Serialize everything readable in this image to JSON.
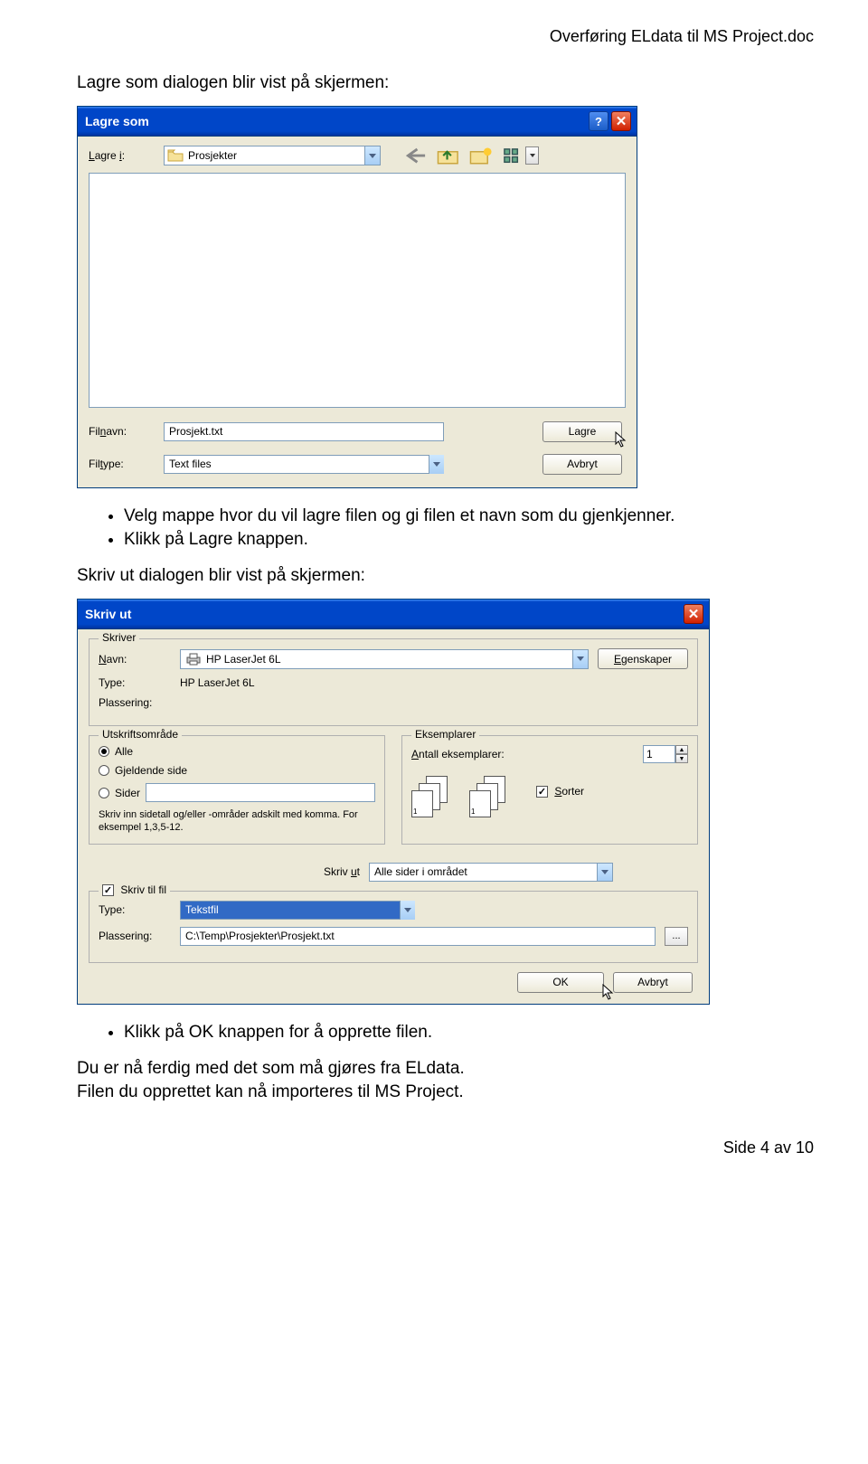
{
  "doc_header": "Overføring ELdata til MS Project.doc",
  "intro_text": "Lagre som dialogen blir vist på skjermen:",
  "saveas": {
    "title": "Lagre som",
    "savein_label": "Lagre i:",
    "folder": "Prosjekter",
    "filename_label": "Filnavn:",
    "filename_value": "Prosjekt.txt",
    "filetype_label": "Filtype:",
    "filetype_value": "Text files",
    "save_btn": "Lagre",
    "cancel_btn": "Avbryt"
  },
  "bullets_after_saveas": [
    "Velg mappe hvor du vil lagre filen og gi filen et navn som du gjenkjenner.",
    "Klikk på Lagre knappen."
  ],
  "print_intro": "Skriv ut dialogen blir vist på skjermen:",
  "print": {
    "title": "Skriv ut",
    "printer_legend": "Skriver",
    "name_label": "Navn:",
    "name_value": "HP LaserJet 6L",
    "type_label": "Type:",
    "type_value": "HP LaserJet 6L",
    "location_label": "Plassering:",
    "props_btn": "Egenskaper",
    "range_legend": "Utskriftsområde",
    "range_all": "Alle",
    "range_current": "Gjeldende side",
    "range_pages": "Sider",
    "range_note": "Skriv inn sidetall og/eller -områder adskilt med komma. For eksempel 1,3,5-12.",
    "copies_legend": "Eksemplarer",
    "copies_label": "Antall eksemplarer:",
    "copies_value": "1",
    "collate": "Sorter",
    "print_what_label": "Skriv ut",
    "print_what_value": "Alle sider i området",
    "to_file_legend": "Skriv til fil",
    "to_file_type_label": "Type:",
    "to_file_type_value": "Tekstfil",
    "to_file_loc_label": "Plassering:",
    "to_file_loc_value": "C:\\Temp\\Prosjekter\\Prosjekt.txt",
    "ok_btn": "OK",
    "cancel_btn": "Avbryt"
  },
  "bullets_after_print": [
    "Klikk på OK knappen for å opprette filen."
  ],
  "closing_lines": [
    "Du er nå ferdig med det som må gjøres fra ELdata.",
    "Filen du opprettet kan nå importeres til MS Project."
  ],
  "footer": "Side 4 av 10"
}
